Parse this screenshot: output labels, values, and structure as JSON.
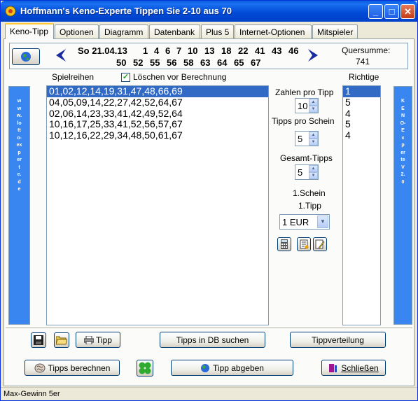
{
  "window": {
    "title": "Hoffmann's Keno-Experte  Tippen Sie 2-10 aus 70",
    "minimize": "_",
    "maximize": "□",
    "close": "✕"
  },
  "tabs": [
    {
      "label": "Keno-Tipp"
    },
    {
      "label": "Optionen"
    },
    {
      "label": "Diagramm"
    },
    {
      "label": "Datenbank"
    },
    {
      "label": "Plus 5"
    },
    {
      "label": "Internet-Optionen"
    },
    {
      "label": "Mitspieler"
    }
  ],
  "draw": {
    "date": "So 21.04.13",
    "row1": [
      "1",
      "4",
      "6",
      "7",
      "10",
      "13",
      "18",
      "22",
      "41",
      "43",
      "46"
    ],
    "row2": [
      "50",
      "52",
      "55",
      "56",
      "58",
      "63",
      "64",
      "65",
      "67"
    ],
    "quersumme_label": "Quersumme:",
    "quersumme_value": "741"
  },
  "labels": {
    "spielreihen": "Spielreihen",
    "loeschen": "Löschen vor Berechnung",
    "richtige": "Richtige",
    "zahlen_pro_tipp": "Zahlen pro Tipp",
    "tipps_pro_schein": "Tipps pro Schein",
    "gesamt_tipps": "Gesamt-Tipps",
    "schein": "1.Schein",
    "tipp": "1.Tipp"
  },
  "spinners": {
    "zahlen_pro_tipp": "10",
    "tipps_pro_schein": "5",
    "gesamt_tipps": "5"
  },
  "einsatz": "1 EUR",
  "spielreihen": [
    "01,02,12,14,19,31,47,48,66,69",
    "04,05,09,14,22,27,42,52,64,67",
    "02,06,14,23,33,41,42,49,52,64",
    "10,16,17,25,33,41,52,56,57,67",
    "10,12,16,22,29,34,48,50,61,67"
  ],
  "richtige": [
    "1",
    "5",
    "4",
    "5",
    "4"
  ],
  "sidebar_left": "www.lotto-experte.de",
  "sidebar_right": "KENO-Experte V 2.0",
  "buttons": {
    "tipp": "Tipp",
    "tipps_in_db": "Tipps in DB suchen",
    "tippverteilung": "Tippverteilung",
    "tipps_berechnen": "Tipps berechnen",
    "tipp_abgeben": "Tipp abgeben",
    "schliessen": "Schließen"
  },
  "status": "Max-Gewinn 5er",
  "colors": {
    "accent": "#316ac5",
    "titlebar": "#0049d6",
    "sidebar": "#3a86f0"
  }
}
